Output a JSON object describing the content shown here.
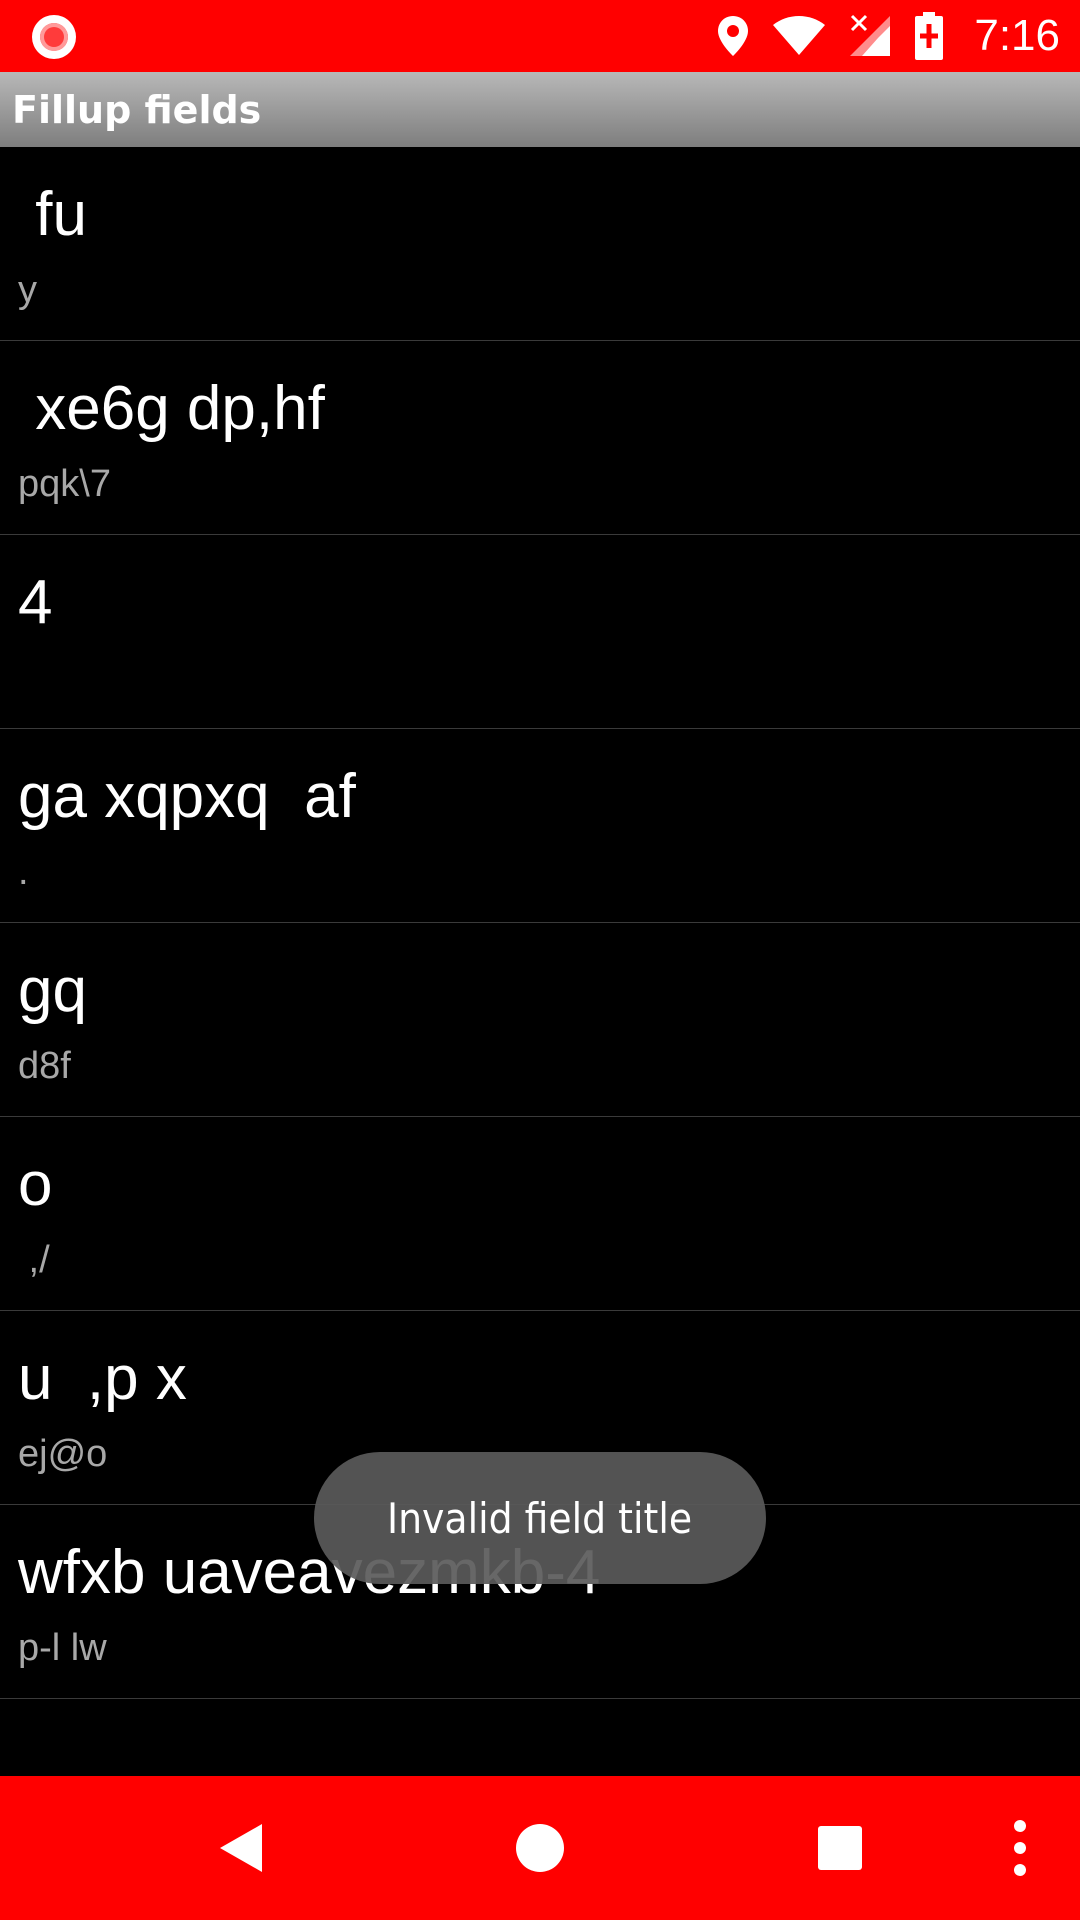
{
  "status_bar": {
    "time": "7:16",
    "icons": [
      "screen-record-icon",
      "location-icon",
      "wifi-icon",
      "cellular-no-signal-icon",
      "battery-charging-icon"
    ]
  },
  "app_bar": {
    "title": "Fillup fields"
  },
  "list": {
    "items": [
      {
        "title": " fu",
        "subtitle": "y"
      },
      {
        "title": " xe6g dp,hf",
        "subtitle": "pqk\\7"
      },
      {
        "title": "4",
        "subtitle": ""
      },
      {
        "title": "ga xqpxq  af",
        "subtitle": "."
      },
      {
        "title": "gq",
        "subtitle": "d8f"
      },
      {
        "title": "o",
        "subtitle": " ,/"
      },
      {
        "title": "u  ,p x",
        "subtitle": "ej@o"
      },
      {
        "title": "wfxb uaveavezmkb-4",
        "subtitle": "p-l lw"
      }
    ]
  },
  "toast": {
    "message": "Invalid field title"
  },
  "nav_bar": {
    "icons": [
      "back-icon",
      "home-icon",
      "recents-icon",
      "overflow-menu-icon"
    ]
  },
  "colors": {
    "status_bar": "#ff0000",
    "nav_bar": "#ff0000",
    "background": "#000000",
    "subtitle": "#a8a8a8"
  }
}
